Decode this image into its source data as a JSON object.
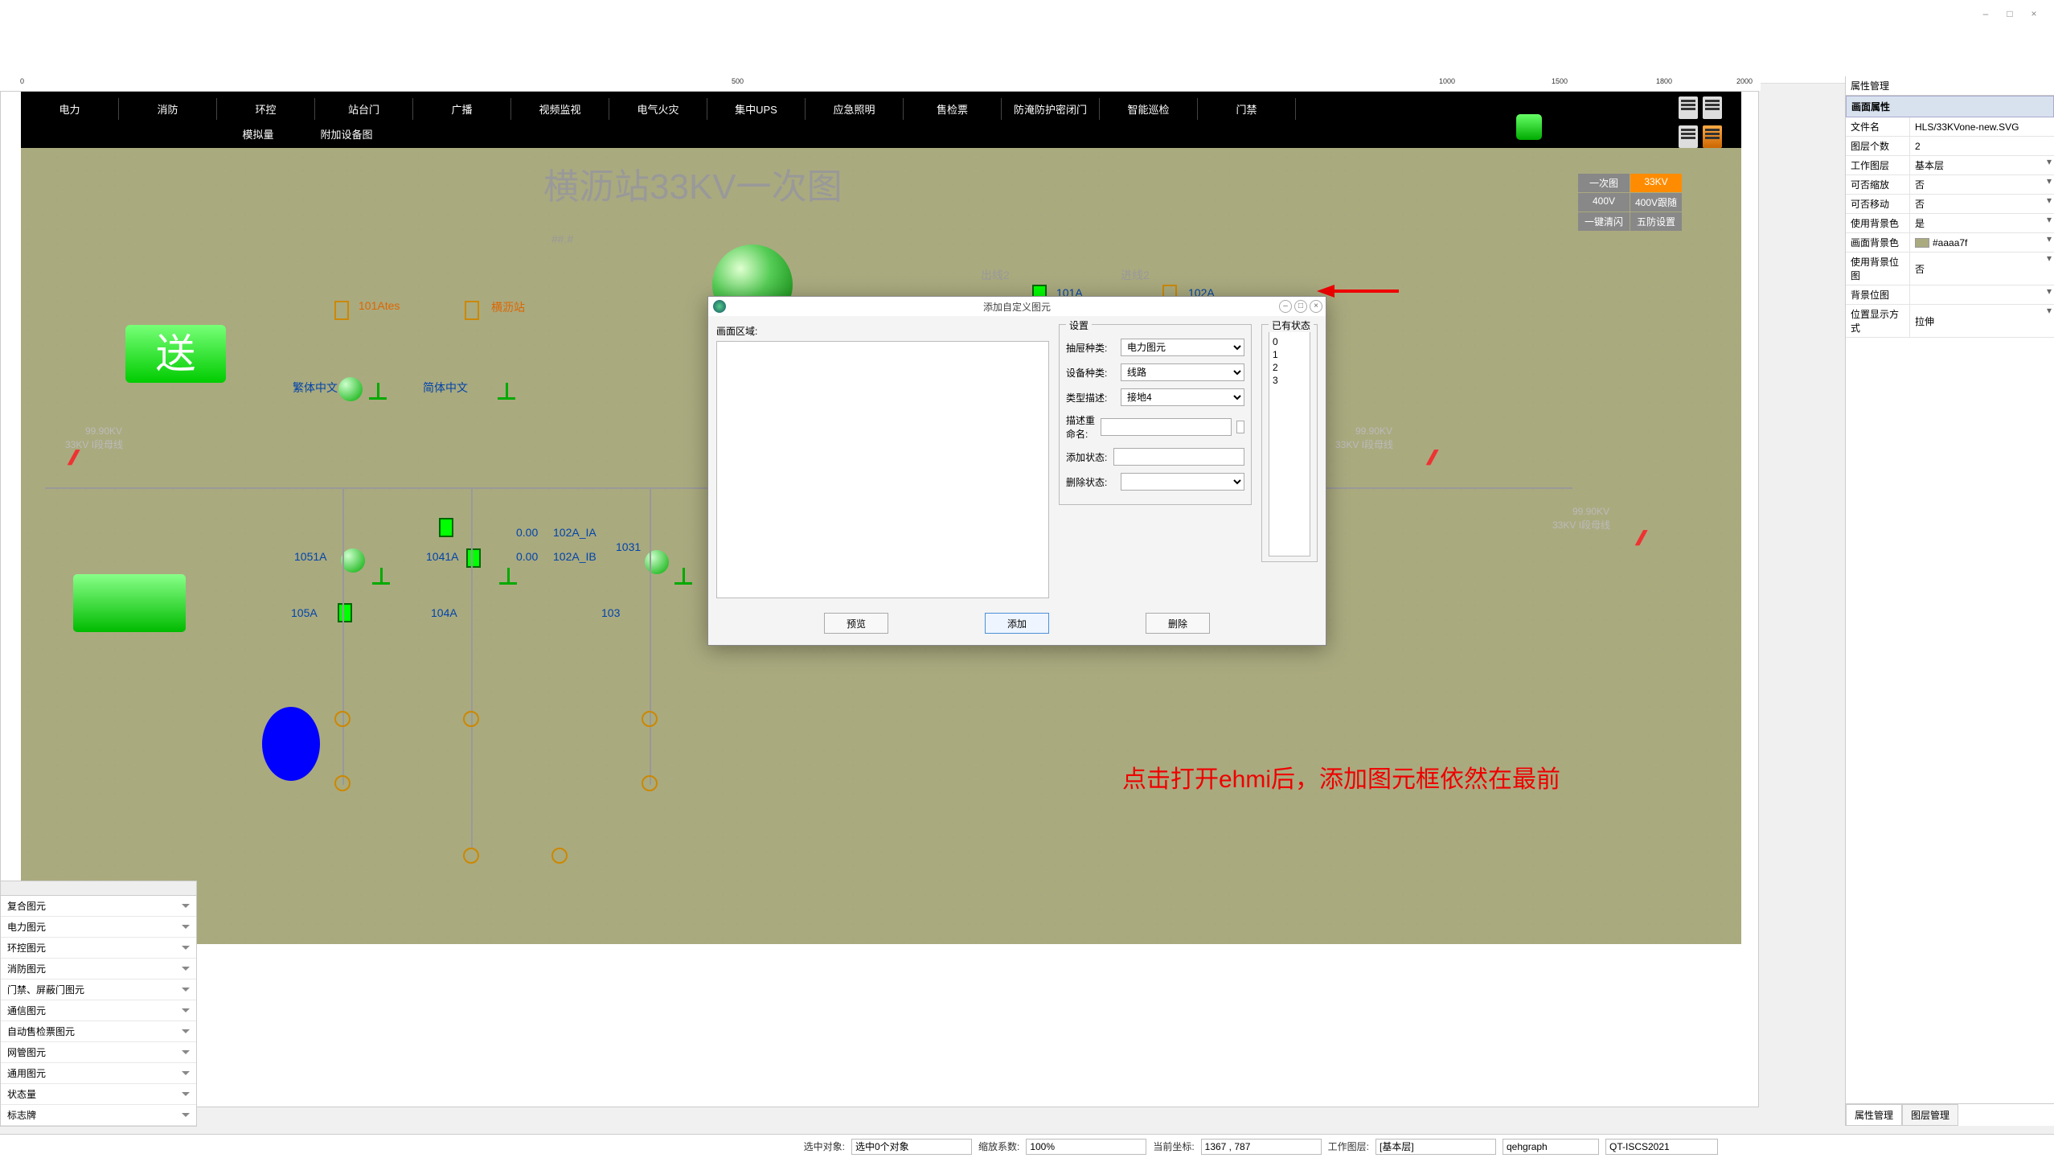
{
  "window": {
    "minimize": "–",
    "maximize": "□",
    "close": "×"
  },
  "nav": {
    "items": [
      "电力",
      "消防",
      "环控",
      "站台门",
      "广播",
      "视频监视",
      "电气火灾",
      "集中UPS",
      "应急照明",
      "售检票",
      "防淹防护密闭门",
      "智能巡检",
      "门禁"
    ],
    "sub": [
      "模拟量",
      "附加设备图"
    ]
  },
  "diagram": {
    "title": "横沥站33KV一次图",
    "hash": "##.#",
    "labels": {
      "l_101Ates": "101Ates",
      "l_hengli": "横沥站",
      "l_fanti": "繁体中文",
      "l_jianti": "简体中文",
      "l_1051A": "1051A",
      "l_1041A": "1041A",
      "l_105A": "105A",
      "l_104A": "104A",
      "l_103": "103",
      "l_102A_IA": "102A_IA",
      "l_102A_IB": "102A_IB",
      "l_1031": "1031",
      "l_000a": "0.00",
      "l_000b": "0.00",
      "l_out2": "出线2",
      "l_101A": "101A",
      "l_in2": "进线2",
      "l_102A": "102A"
    },
    "kv1": "99.90KV",
    "kv1b": "33KV I段母线",
    "kv2": "99.90KV",
    "kv2b": "33KV I段母线",
    "kv3": "99.90KV",
    "kv3b": "33KV I段母线",
    "song": "送",
    "red_note": "点击打开ehmi后，添加图元框依然在最前"
  },
  "status_grid": {
    "r1": [
      "一次图",
      "33KV"
    ],
    "r2": [
      "400V",
      "400V跟随"
    ],
    "r3": [
      "一键清闪",
      "五防设置"
    ]
  },
  "ruler": {
    "t0": "0",
    "t1": "500",
    "t2": "1000",
    "t3": "1500",
    "t4": "1800",
    "t5": "2000"
  },
  "dialog": {
    "title": "添加自定义图元",
    "area_label": "画面区域:",
    "legend_set": "设置",
    "legend_status": "已有状态",
    "f_type": "抽屉种类:",
    "v_type": "电力图元",
    "f_device": "设备种类:",
    "v_device": "线路",
    "f_desc": "类型描述:",
    "v_desc": "接地4",
    "f_rename": "描述重命名:",
    "f_addstate": "添加状态:",
    "f_delstate": "删除状态:",
    "states": [
      "0",
      "1",
      "2",
      "3"
    ],
    "btn_preview": "预览",
    "btn_add": "添加",
    "btn_del": "删除"
  },
  "palette": {
    "items": [
      "复合图元",
      "电力图元",
      "环控图元",
      "消防图元",
      "门禁、屏蔽门图元",
      "通信图元",
      "自动售检票图元",
      "网管图元",
      "通用图元",
      "状态量",
      "标志牌"
    ]
  },
  "props": {
    "title": "属性管理",
    "header": "画面属性",
    "rows": [
      {
        "k": "文件名",
        "v": "HLS/33KVone-new.SVG"
      },
      {
        "k": "图层个数",
        "v": "2"
      },
      {
        "k": "工作图层",
        "v": "基本层",
        "dd": true
      },
      {
        "k": "可否缩放",
        "v": "否",
        "dd": true
      },
      {
        "k": "可否移动",
        "v": "否",
        "dd": true
      },
      {
        "k": "使用背景色",
        "v": "是",
        "dd": true
      },
      {
        "k": "画面背景色",
        "v": "#aaaa7f",
        "swatch": true,
        "dd": true
      },
      {
        "k": "使用背景位图",
        "v": "否",
        "dd": true
      },
      {
        "k": "背景位图",
        "v": "",
        "dd": true
      },
      {
        "k": "位置显示方式",
        "v": "拉伸",
        "dd": true
      }
    ],
    "tab1": "属性管理",
    "tab2": "图层管理"
  },
  "statusbar": {
    "sel_label": "选中对象:",
    "sel_val": "选中0个对象",
    "zoom_label": "缩放系数:",
    "zoom_val": "100%",
    "coord_label": "当前坐标:",
    "coord_val": "1367 , 787",
    "layer_label": "工作图层:",
    "layer_val": "[基本层]",
    "user": "qehgraph",
    "sys": "QT-ISCS2021"
  }
}
